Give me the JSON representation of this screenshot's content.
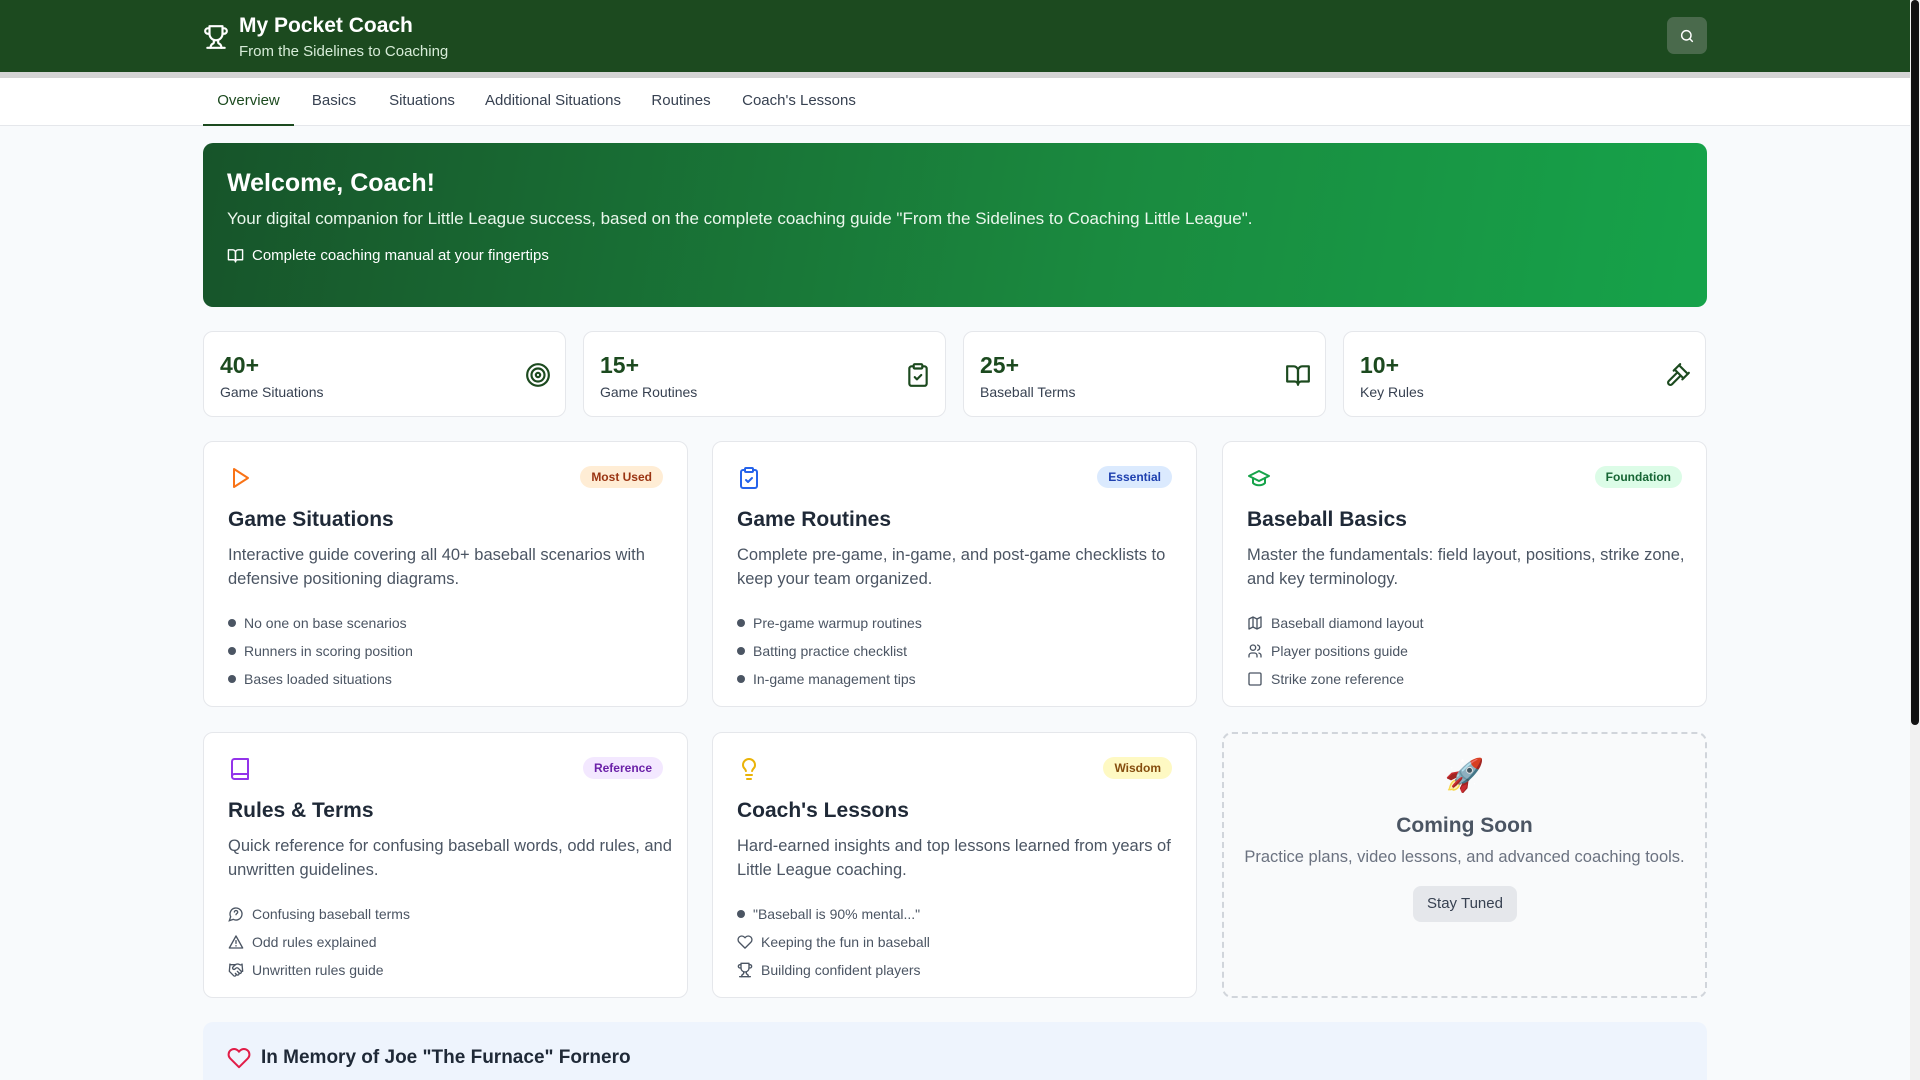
{
  "header": {
    "title": "My Pocket Coach",
    "subtitle": "From the Sidelines to Coaching"
  },
  "tabs": [
    {
      "label": "Overview",
      "active": true
    },
    {
      "label": "Basics",
      "active": false
    },
    {
      "label": "Situations",
      "active": false
    },
    {
      "label": "Additional Situations",
      "active": false
    },
    {
      "label": "Routines",
      "active": false
    },
    {
      "label": "Coach's Lessons",
      "active": false
    }
  ],
  "hero": {
    "title": "Welcome, Coach!",
    "description": "Your digital companion for Little League success, based on the complete coaching guide \"From the Sidelines to Coaching Little League\".",
    "note": "Complete coaching manual at your fingertips"
  },
  "stats": [
    {
      "value": "40+",
      "label": "Game Situations",
      "icon": "target-icon"
    },
    {
      "value": "15+",
      "label": "Game Routines",
      "icon": "clipboard-check-icon"
    },
    {
      "value": "25+",
      "label": "Baseball Terms",
      "icon": "book-open-icon"
    },
    {
      "value": "10+",
      "label": "Key Rules",
      "icon": "gavel-icon"
    }
  ],
  "cards": [
    {
      "title": "Game Situations",
      "badge": "Most Used",
      "description": "Interactive guide covering all 40+ baseball scenarios with defensive positioning diagrams.",
      "items": [
        "No one on base scenarios",
        "Runners in scoring position",
        "Bases loaded situations"
      ],
      "colors": {
        "accent": "#f97316",
        "badge_bg": "#ffedd5",
        "badge_text": "#9a3412"
      }
    },
    {
      "title": "Game Routines",
      "badge": "Essential",
      "description": "Complete pre-game, in-game, and post-game checklists to keep your team organized.",
      "items": [
        "Pre-game warmup routines",
        "Batting practice checklist",
        "In-game management tips"
      ],
      "colors": {
        "accent": "#2563eb",
        "badge_bg": "#dbeafe",
        "badge_text": "#1e40af"
      }
    },
    {
      "title": "Baseball Basics",
      "badge": "Foundation",
      "description": "Master the fundamentals: field layout, positions, strike zone, and key terminology.",
      "items": [
        "Baseball diamond layout",
        "Player positions guide",
        "Strike zone reference"
      ],
      "colors": {
        "accent": "#16a34a",
        "badge_bg": "#dcfce7",
        "badge_text": "#166534"
      }
    },
    {
      "title": "Rules & Terms",
      "badge": "Reference",
      "description": "Quick reference for confusing baseball words, odd rules, and unwritten guidelines.",
      "items": [
        "Confusing baseball terms",
        "Odd rules explained",
        "Unwritten rules guide"
      ],
      "colors": {
        "accent": "#9333ea",
        "badge_bg": "#f3e8ff",
        "badge_text": "#6b21a8"
      }
    },
    {
      "title": "Coach's Lessons",
      "badge": "Wisdom",
      "description": "Hard-earned insights and top lessons learned from years of Little League coaching.",
      "items": [
        "\"Baseball is 90% mental...\"",
        "Keeping the fun in baseball",
        "Building confident players"
      ],
      "colors": {
        "accent": "#eab308",
        "badge_bg": "#fef9c3",
        "badge_text": "#854d0e"
      }
    }
  ],
  "coming_soon": {
    "title": "Coming Soon",
    "description": "Practice plans, video lessons, and advanced coaching tools.",
    "button": "Stay Tuned"
  },
  "memorial": {
    "title": "In Memory of Joe \"The Furnace\" Fornero"
  },
  "colors": {
    "header_bg": "#1c4a1f",
    "primary_green": "#16a34a",
    "memorial_heart": "#e11d48"
  }
}
